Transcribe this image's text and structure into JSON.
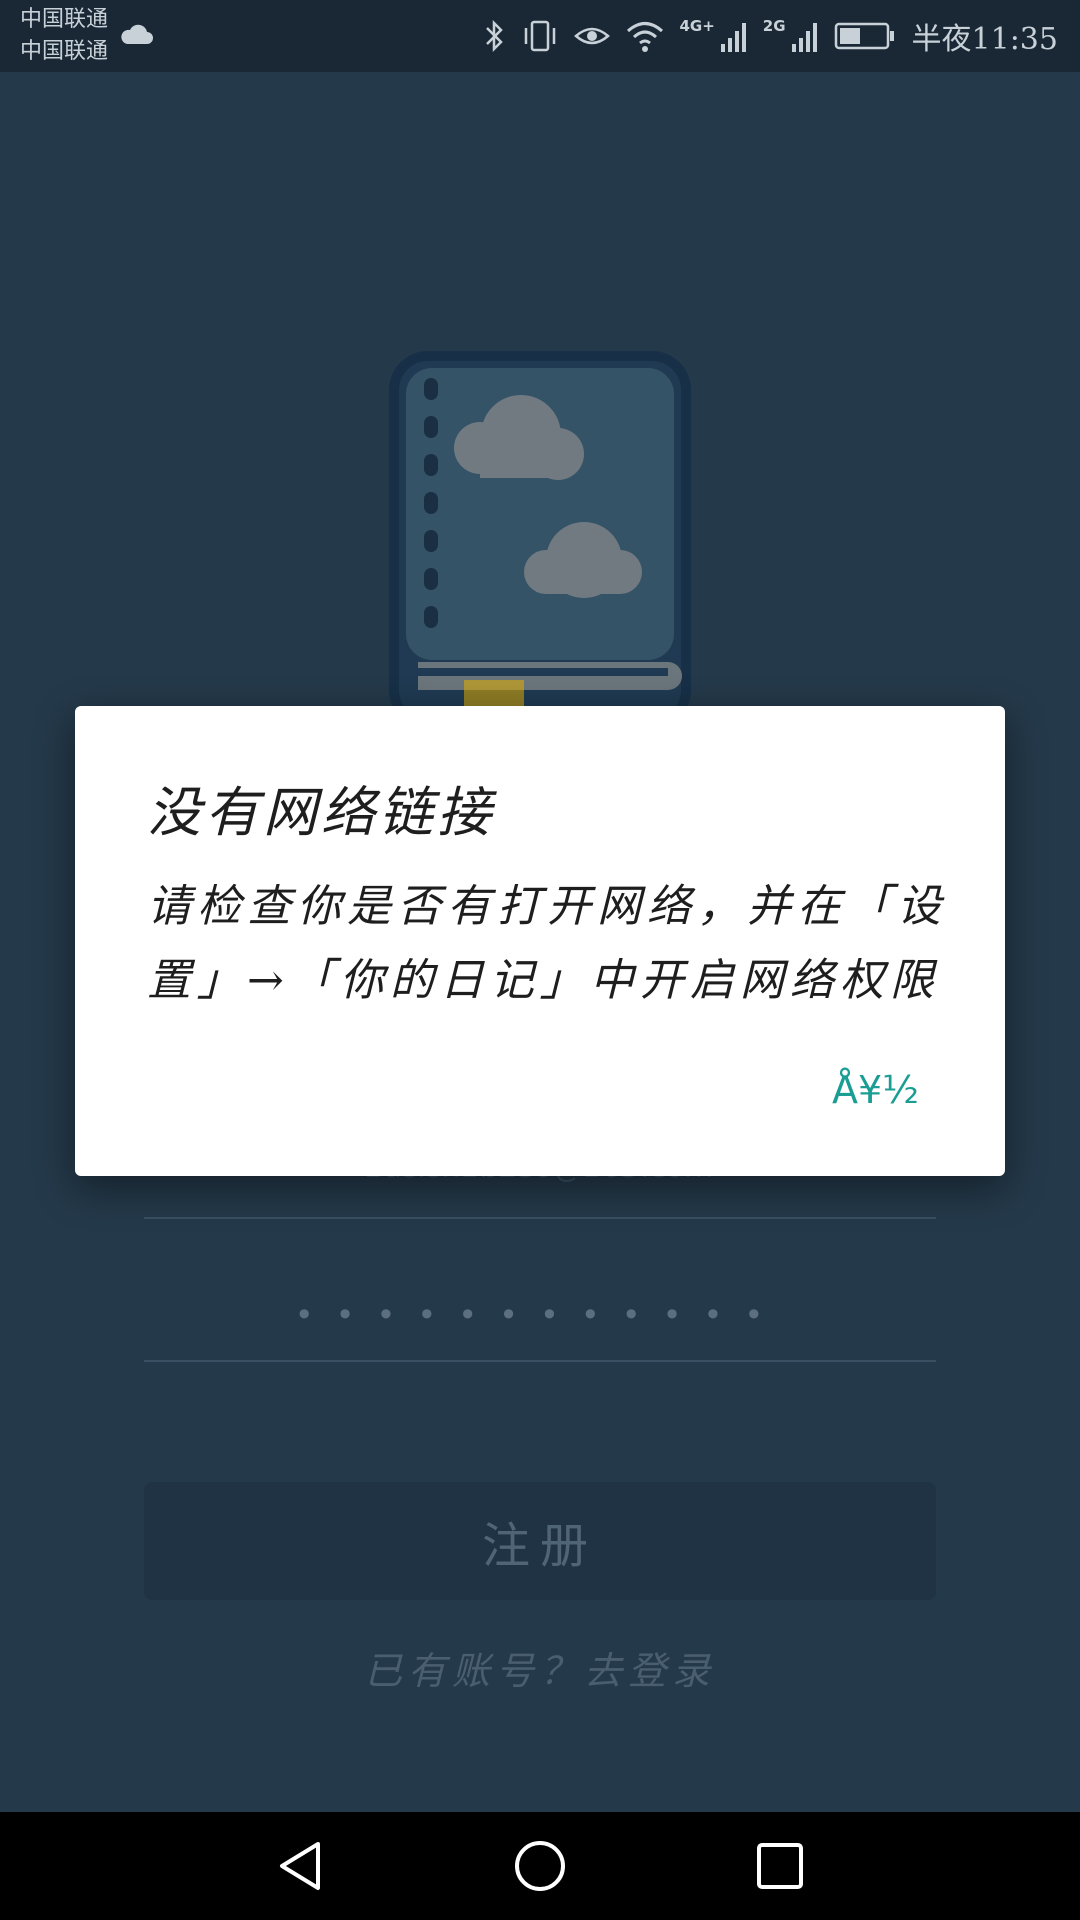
{
  "status_bar": {
    "carrier_1": "中国联通",
    "carrier_2": "中国联通",
    "network_1": "4G+",
    "network_2": "2G",
    "time": "半夜11:35",
    "icons": [
      "cloud-icon",
      "bluetooth-icon",
      "vibrate-icon",
      "eye-icon",
      "wifi-icon",
      "signal-icon",
      "battery-icon"
    ]
  },
  "background": {
    "email_value": "1dsish1b2s6@163.com",
    "password_value": "••••••••••••",
    "register_label": "注册",
    "login_link": "已有账号？去登录"
  },
  "dialog": {
    "title": "没有网络链接",
    "message": "请检查你是否有打开网络，并在「设置」→「你的日记」中开启网络权限",
    "ok_label": "Å¥½"
  },
  "colors": {
    "accent": "#1a9e94",
    "bookmark": "#e8b200"
  }
}
